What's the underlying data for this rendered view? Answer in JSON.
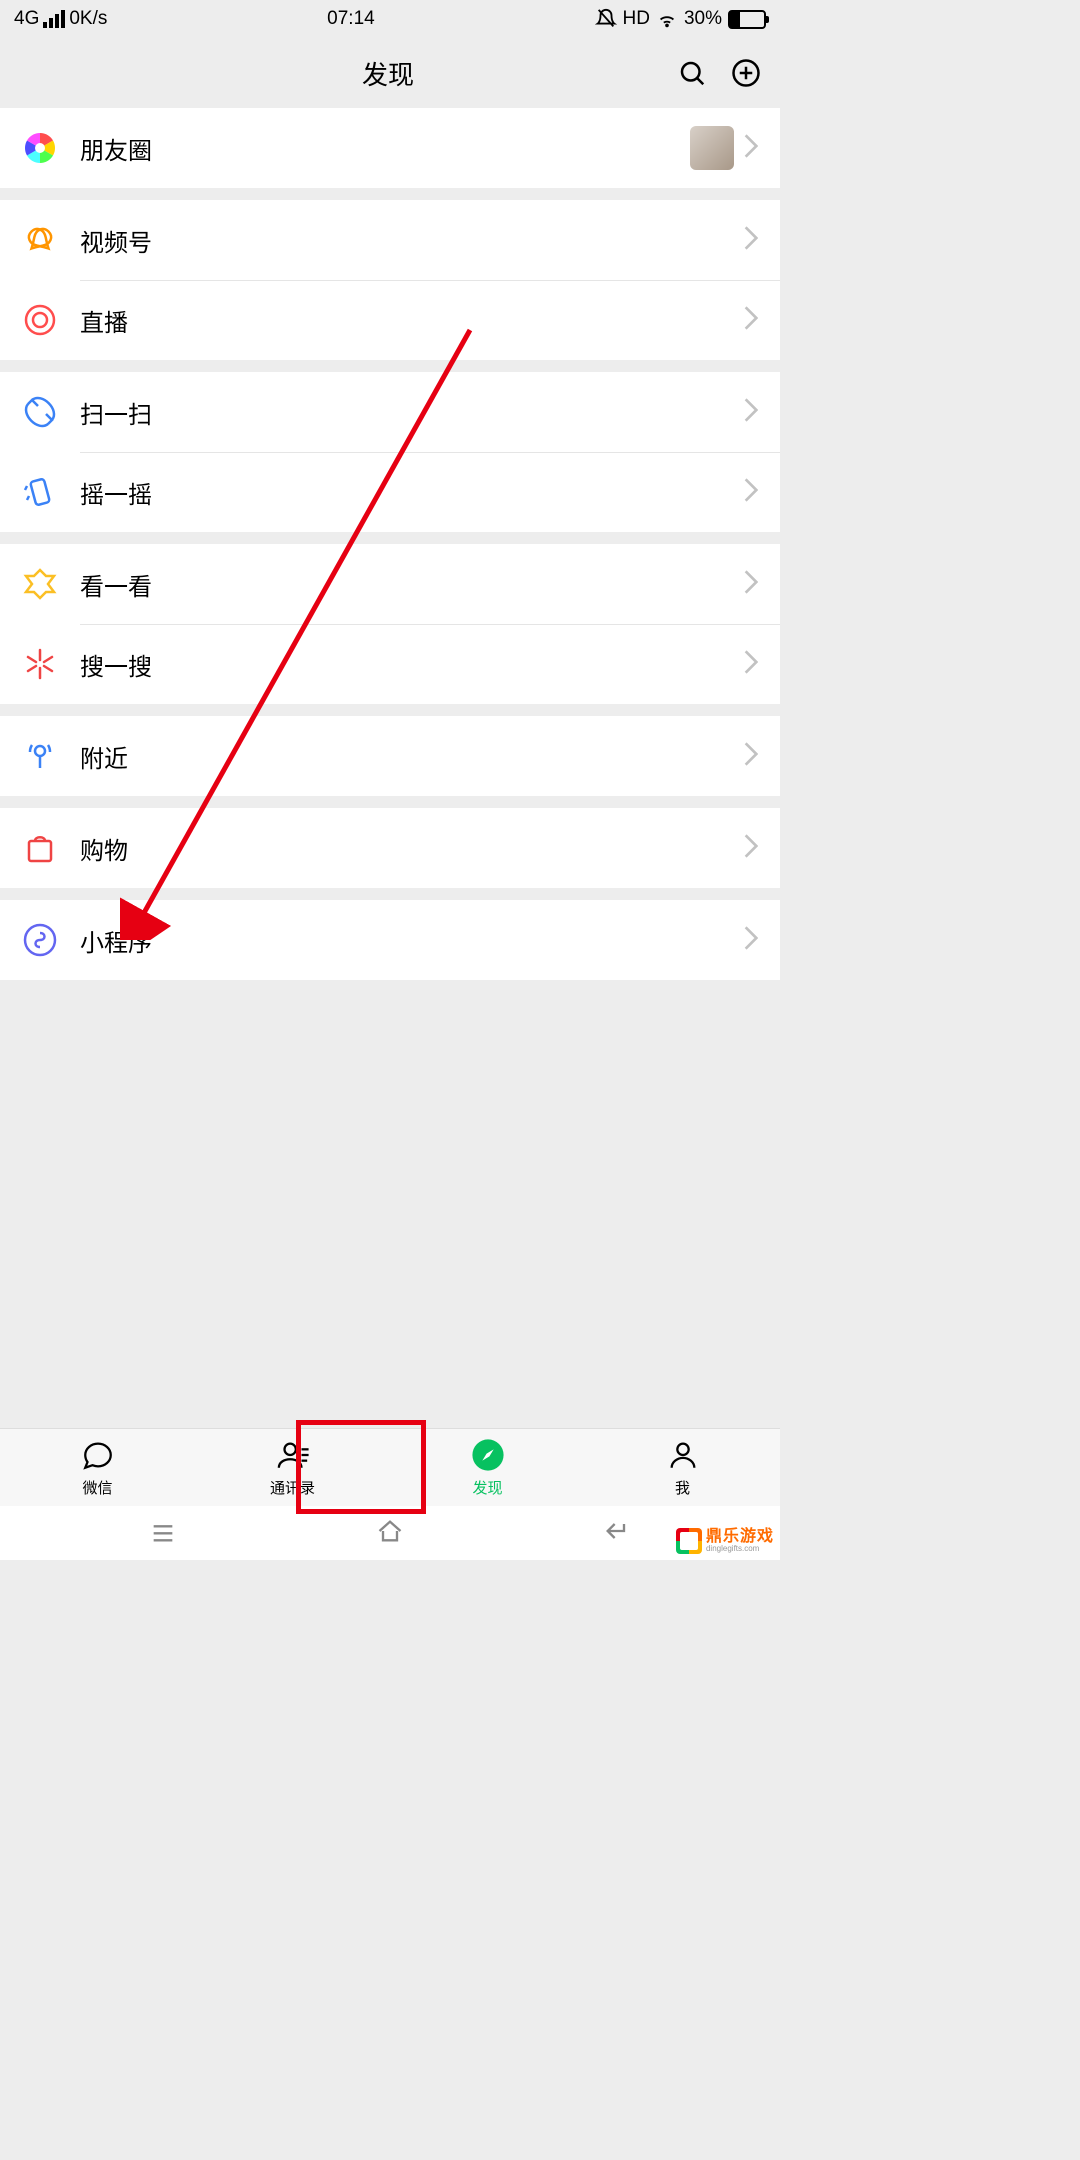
{
  "status": {
    "network": "4G",
    "speed": "0K/s",
    "time": "07:14",
    "hd": "HD",
    "battery_pct": "30%"
  },
  "header": {
    "title": "发现"
  },
  "rows": {
    "moments": "朋友圈",
    "channels": "视频号",
    "live": "直播",
    "scan": "扫一扫",
    "shake": "摇一摇",
    "topstories": "看一看",
    "search": "搜一搜",
    "nearby": "附近",
    "shopping": "购物",
    "miniapp": "小程序"
  },
  "tabs": {
    "wechat": "微信",
    "contacts": "通讯录",
    "discover": "发现",
    "me": "我"
  },
  "watermark": {
    "main": "鼎乐游戏",
    "sub": "dinglegifts.com"
  }
}
